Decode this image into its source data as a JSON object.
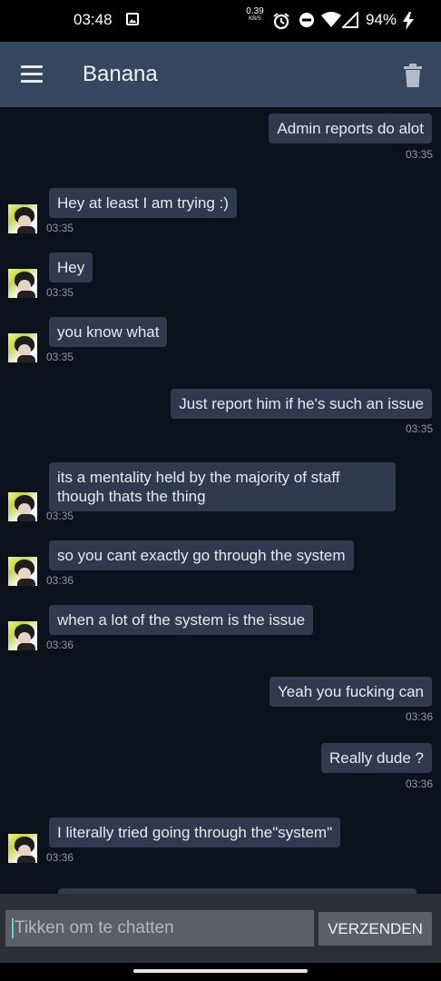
{
  "status_bar": {
    "time": "03:48",
    "net_speed": "0.39",
    "net_unit": "KB/S",
    "battery": "94%",
    "icons": [
      "image-icon",
      "alarm-icon",
      "dnd-icon",
      "wifi-icon",
      "signal-icon",
      "charging-icon"
    ]
  },
  "app_bar": {
    "title": "Banana",
    "menu_icon": "hamburger-menu-icon",
    "delete_icon": "trash-icon"
  },
  "messages": [
    {
      "side": "out",
      "text": "Admin reports do alot",
      "time": "03:35"
    },
    {
      "side": "in",
      "text": "Hey at least I am trying :)",
      "time": "03:35"
    },
    {
      "side": "in",
      "text": "Hey",
      "time": "03:35"
    },
    {
      "side": "in",
      "text": "you know what",
      "time": "03:35"
    },
    {
      "side": "out",
      "text": "Just report him if he's such an issue",
      "time": "03:35"
    },
    {
      "side": "in",
      "text": "its a mentality held by the majority of staff though thats the thing",
      "time": "03:35"
    },
    {
      "side": "in",
      "text": "so you cant exactly go through the system",
      "time": "03:36"
    },
    {
      "side": "in",
      "text": "when a lot of the system is the issue",
      "time": "03:36"
    },
    {
      "side": "out",
      "text": "Yeah you fucking can",
      "time": "03:36"
    },
    {
      "side": "out",
      "text": "Really dude ?",
      "time": "03:36"
    },
    {
      "side": "in",
      "text": "I literally tried going through the\"system\"",
      "time": "03:36"
    }
  ],
  "composer": {
    "placeholder": "Tikken om te chatten",
    "send_label": "VERZENDEN"
  },
  "colors": {
    "background": "#0c121c",
    "app_bar": "#34475f",
    "bubble": "#31394f",
    "caret": "#5fd0c8"
  }
}
